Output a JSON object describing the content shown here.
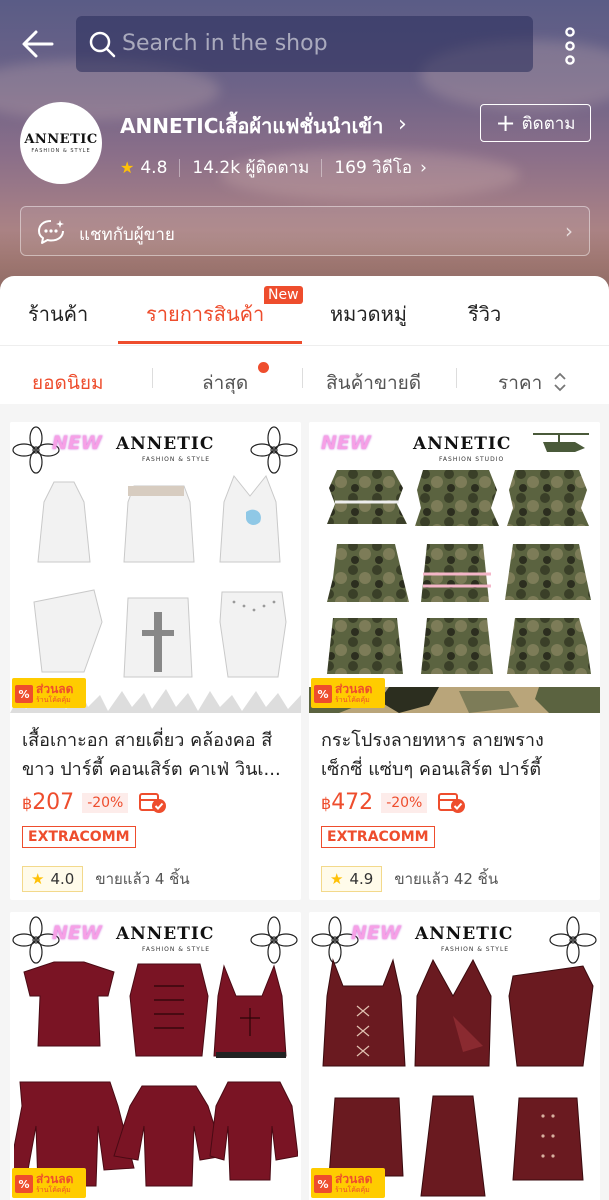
{
  "header": {
    "search_placeholder": "Search in the shop",
    "shop_name": "ANNETICเสื้อผ้าแฟชั่นนำเข้า",
    "logo_text": "ANNETIC",
    "logo_subtext": "FASHION & STYLE",
    "rating": "4.8",
    "followers": "14.2k ผู้ติดตาม",
    "videos": "169 วิดีโอ",
    "follow_label": "ติดตาม",
    "chat_label": "แชทกับผู้ขาย"
  },
  "tabs": {
    "items": [
      "ร้านค้า",
      "รายการสินค้า",
      "หมวดหมู่",
      "รีวิว"
    ],
    "active_index": 1,
    "new_badge": "New"
  },
  "sort": {
    "items": [
      "ยอดนิยม",
      "ล่าสุด",
      "สินค้าขายดี",
      "ราคา"
    ],
    "active_index": 0
  },
  "products": [
    {
      "title": "เสื้อเกาะอก สายเดี่ยว คล้องคอ สีขาว ปาร์ตี้ คอนเสิร์ต คาเฟ่ วินเ...",
      "currency": "฿",
      "price": "207",
      "discount": "-20%",
      "badge": "EXTRACOMM",
      "rating": "4.0",
      "sold": "ขายแล้ว 4 ชิ้น",
      "new_tag": "NEW",
      "brand": "ANNETIC",
      "brand_sub": "FASHION & STYLE",
      "promo_l1": "ส่วนลด",
      "promo_l2": "ร้านโค้ดคุ้ม"
    },
    {
      "title": "กระโปรงลายทหาร ลายพราง เซ็กซี่ แซ่บๆ คอนเสิร์ต ปาร์ตี้",
      "currency": "฿",
      "price": "472",
      "discount": "-20%",
      "badge": "EXTRACOMM",
      "rating": "4.9",
      "sold": "ขายแล้ว 42 ชิ้น",
      "new_tag": "NEW",
      "brand": "ANNETIC",
      "brand_sub": "FASHION STUDIO",
      "promo_l1": "ส่วนลด",
      "promo_l2": "ร้านโค้ดคุ้ม"
    },
    {
      "new_tag": "NEW",
      "brand": "ANNETIC",
      "brand_sub": "FASHION & STYLE",
      "promo_l1": "ส่วนลด",
      "promo_l2": "ร้านโค้ดคุ้ม"
    },
    {
      "new_tag": "NEW",
      "brand": "ANNETIC",
      "brand_sub": "FASHION & STYLE",
      "promo_l1": "ส่วนลด",
      "promo_l2": "ร้านโค้ดคุ้ม"
    }
  ],
  "colors": {
    "accent": "#ee4d2d",
    "star": "#ffc107",
    "promo": "#ffcc00"
  }
}
